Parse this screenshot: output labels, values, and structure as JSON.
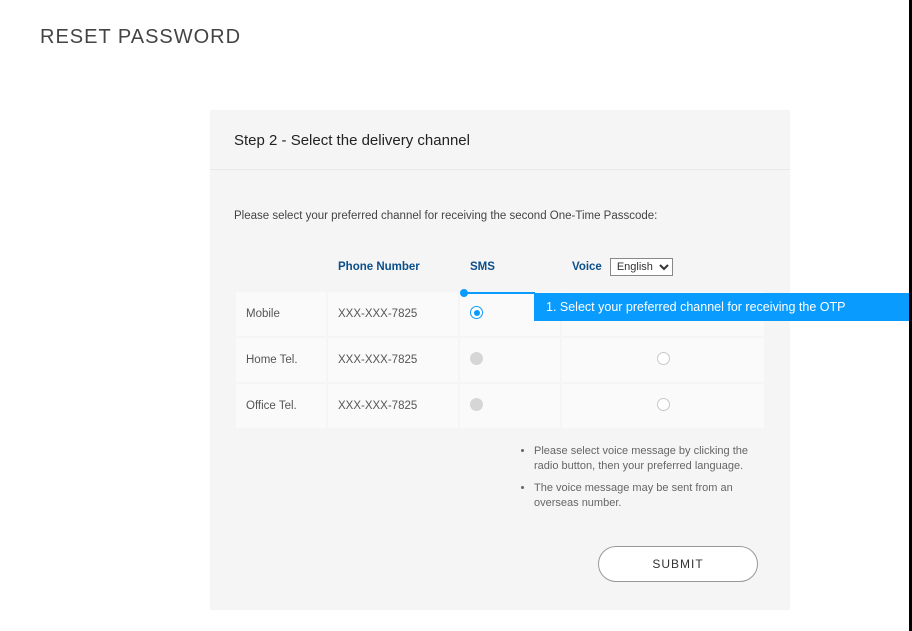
{
  "page_title": "RESET PASSWORD",
  "step_title": "Step 2 - Select the delivery channel",
  "instruction": "Please select your preferred channel for receiving the second One-Time Passcode:",
  "columns": {
    "phone": "Phone Number",
    "sms": "SMS",
    "voice": "Voice"
  },
  "language_select": "English",
  "rows": [
    {
      "label": "Mobile",
      "phone": "XXX-XXX-7825",
      "sms_state": "selected",
      "voice_visible": false
    },
    {
      "label": "Home Tel.",
      "phone": "XXX-XXX-7825",
      "sms_state": "disabled",
      "voice_visible": true
    },
    {
      "label": "Office Tel.",
      "phone": "XXX-XXX-7825",
      "sms_state": "disabled",
      "voice_visible": true
    }
  ],
  "notes": [
    "Please select voice message by clicking the radio button, then your preferred language.",
    "The voice message may be sent from an overseas number."
  ],
  "submit_label": "SUBMIT",
  "callout": "1. Select your preferred channel for receiving the OTP"
}
